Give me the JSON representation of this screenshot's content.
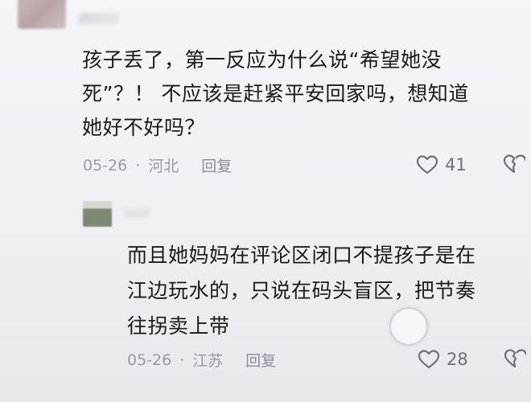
{
  "comments": [
    {
      "text": "孩子丢了，第一反应为什么说“希望她没\n死”？！ 不应该是赶紧平安回家吗，想知道\n她好不好吗？",
      "date": "05-26",
      "separator": "·",
      "location": "河北",
      "reply_label": "回复",
      "likes": "41"
    },
    {
      "text": "而且她妈妈在评论区闭口不提孩子是在\n江边玩水的，只说在码头盲区，把节奏\n往拐卖上带",
      "date": "05-26",
      "separator": "·",
      "location": "江苏",
      "reply_label": "回复",
      "likes": "28"
    }
  ],
  "icons": {
    "like": "heart-outline-icon",
    "dislike": "broken-heart-icon"
  }
}
